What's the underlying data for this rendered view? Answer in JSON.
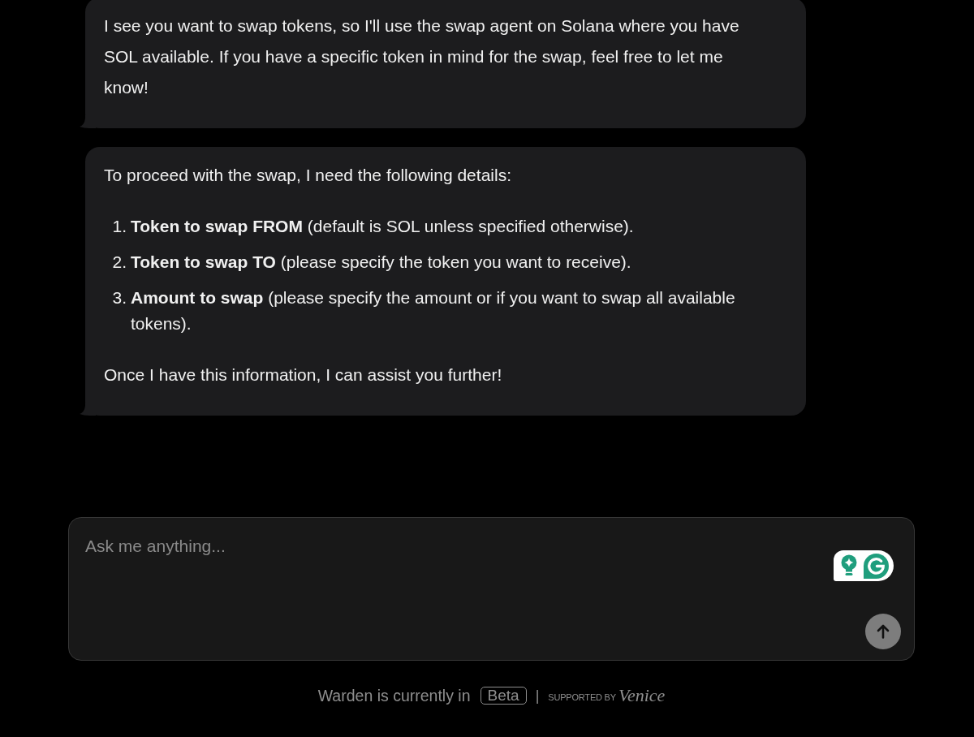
{
  "messages": [
    {
      "blocks": [
        {
          "kind": "paragraph",
          "text": "I see you want to swap tokens, so I'll use the swap agent on Solana where you have SOL available. If you have a specific token in mind for the swap, feel free to let me know!"
        }
      ]
    },
    {
      "blocks": [
        {
          "kind": "paragraph",
          "text": "To proceed with the swap, I need the following details:"
        },
        {
          "kind": "ordered_list",
          "items": [
            {
              "number": "1.",
              "text": "**Token to swap FROM** (default is SOL unless specified otherwise)."
            },
            {
              "number": "2.",
              "text": "**Token to swap TO** (please specify the token you want to receive)."
            },
            {
              "number": "3.",
              "text": "**Amount to swap** (please specify the amount or if you want to swap all available tokens)."
            }
          ]
        },
        {
          "kind": "paragraph",
          "text": "Once I have this information, I can assist you further!"
        }
      ]
    }
  ],
  "composer": {
    "placeholder": "Ask me anything..."
  },
  "footer": {
    "status": "Warden is currently in",
    "badge": "Beta",
    "separator": "|",
    "supported_by": "SUPPORTED BY",
    "sponsor": "Venice"
  }
}
